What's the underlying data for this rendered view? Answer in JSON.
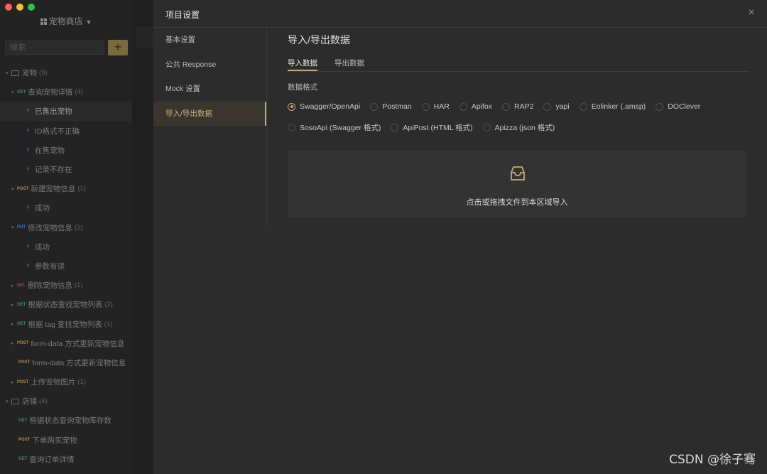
{
  "window": {
    "project_name": "宠物商店"
  },
  "sidebar": {
    "search_placeholder": "搜索",
    "add_label": "+",
    "tree": [
      {
        "kind": "folder",
        "indent": 0,
        "label": "宠物",
        "count": "(9)"
      },
      {
        "kind": "api",
        "indent": 1,
        "method": "GET",
        "label": "查询宠物详情",
        "count": "(4)"
      },
      {
        "kind": "case",
        "indent": 2,
        "label": "已售出宠物",
        "selected": true
      },
      {
        "kind": "case",
        "indent": 2,
        "label": "ID格式不正确"
      },
      {
        "kind": "case",
        "indent": 2,
        "label": "在售宠物"
      },
      {
        "kind": "case",
        "indent": 2,
        "label": "记录不存在"
      },
      {
        "kind": "api",
        "indent": 1,
        "method": "POST",
        "label": "新建宠物信息",
        "count": "(1)"
      },
      {
        "kind": "case",
        "indent": 2,
        "label": "成功"
      },
      {
        "kind": "api",
        "indent": 1,
        "method": "PUT",
        "label": "修改宠物信息",
        "count": "(2)"
      },
      {
        "kind": "case",
        "indent": 2,
        "label": "成功"
      },
      {
        "kind": "case",
        "indent": 2,
        "label": "参数有误"
      },
      {
        "kind": "api",
        "indent": 1,
        "method": "DEL",
        "label": "删除宠物信息",
        "count": "(1)"
      },
      {
        "kind": "api",
        "indent": 1,
        "method": "GET",
        "label": "根据状态查找宠物列表",
        "count": "(2)"
      },
      {
        "kind": "api",
        "indent": 1,
        "method": "GET",
        "label": "根据 tag 查找宠物列表",
        "count": "(1)"
      },
      {
        "kind": "api",
        "indent": 1,
        "method": "POST",
        "label": "form-data 方式更新宠物信息",
        "count": ""
      },
      {
        "kind": "api",
        "indent": 1,
        "method": "POST",
        "label": "form-data 方式更新宠物信息",
        "count": "",
        "noarrow": true
      },
      {
        "kind": "api",
        "indent": 1,
        "method": "POST",
        "label": "上传宠物图片",
        "count": "(1)"
      },
      {
        "kind": "folder",
        "indent": 0,
        "label": "店铺",
        "count": "(4)"
      },
      {
        "kind": "api",
        "indent": 1,
        "method": "GET",
        "label": "根据状态查询宠物库存数",
        "count": "",
        "noarrow": true
      },
      {
        "kind": "api",
        "indent": 1,
        "method": "POST",
        "label": "下单购买宠物",
        "count": "",
        "noarrow": true
      },
      {
        "kind": "api",
        "indent": 1,
        "method": "GET",
        "label": "查询订单详情",
        "count": "",
        "noarrow": true
      }
    ]
  },
  "modal": {
    "title": "项目设置",
    "close_label": "×",
    "nav": [
      {
        "label": "基本设置",
        "active": false
      },
      {
        "label": "公共 Response",
        "active": false
      },
      {
        "label": "Mock 设置",
        "active": false
      },
      {
        "label": "导入/导出数据",
        "active": true
      }
    ],
    "content_title": "导入/导出数据",
    "tabs": [
      {
        "label": "导入数据",
        "active": true
      },
      {
        "label": "导出数据",
        "active": false
      }
    ],
    "format_label": "数据格式",
    "formats_row1": [
      {
        "label": "Swagger/OpenApi",
        "checked": true
      },
      {
        "label": "Postman",
        "checked": false
      },
      {
        "label": "HAR",
        "checked": false
      },
      {
        "label": "Apifox",
        "checked": false
      },
      {
        "label": "RAP2",
        "checked": false
      },
      {
        "label": "yapi",
        "checked": false
      },
      {
        "label": "Eolinker (.amsp)",
        "checked": false
      },
      {
        "label": "DOClever",
        "checked": false
      }
    ],
    "formats_row2": [
      {
        "label": "SosoApi (Swagger 格式)",
        "checked": false
      },
      {
        "label": "ApiPost (HTML 格式)",
        "checked": false
      },
      {
        "label": "Apizza (json 格式)",
        "checked": false
      }
    ],
    "dropzone_text": "点击或拖拽文件到本区域导入",
    "dropzone_icon": "inbox-icon"
  },
  "watermark": "CSDN @徐子骞",
  "colors": {
    "accent": "#c9a86a",
    "modal_bg": "#2c2c2c",
    "sidebar_bg": "#232323"
  }
}
